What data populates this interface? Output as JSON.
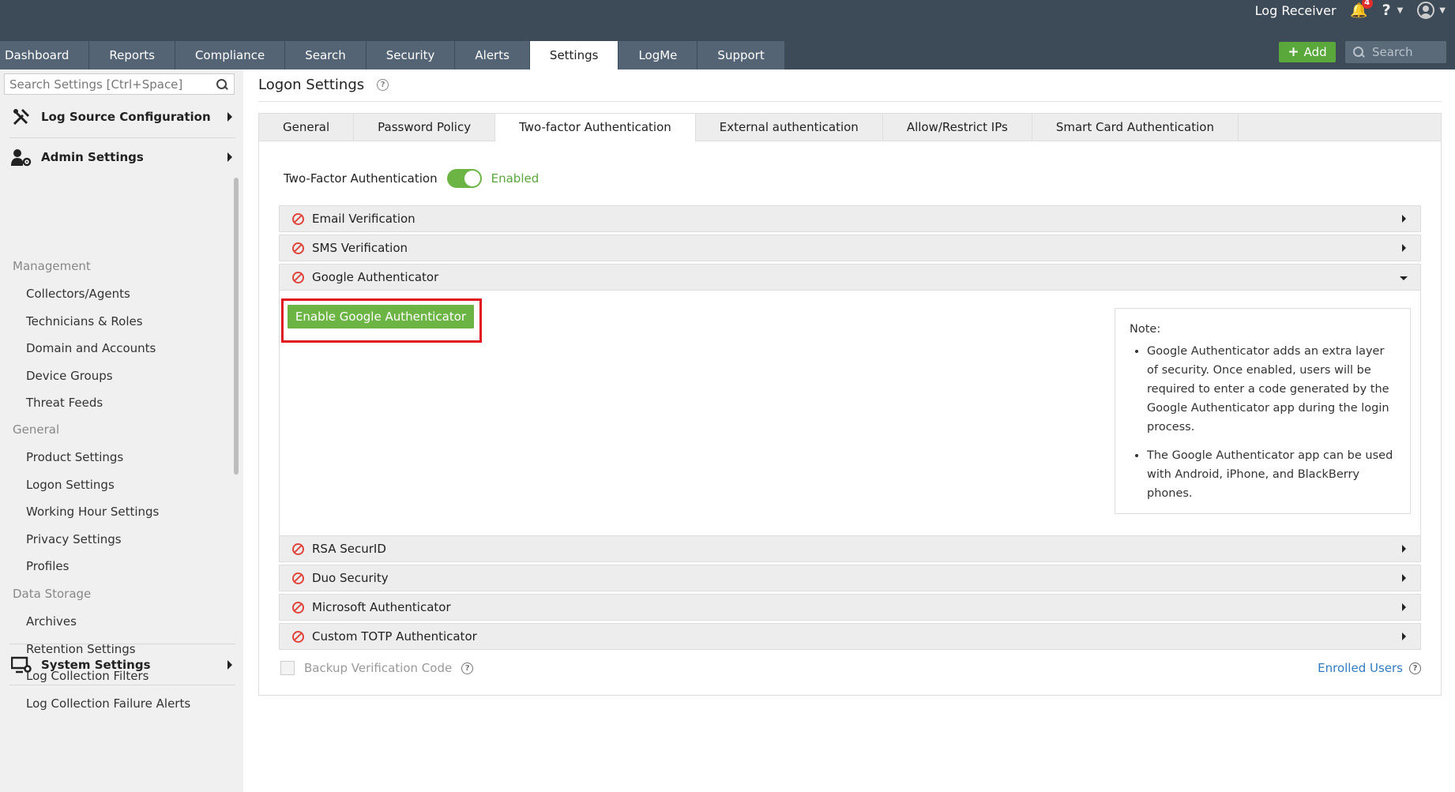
{
  "header": {
    "app_name": "Log Receiver",
    "notification_count": "4",
    "help_label": "?",
    "nav_tabs": [
      "Dashboard",
      "Reports",
      "Compliance",
      "Search",
      "Security",
      "Alerts",
      "Settings",
      "LogMe",
      "Support"
    ],
    "active_tab": "Settings",
    "add_label": "Add",
    "search_placeholder": "Search"
  },
  "sidebar": {
    "search_placeholder": "Search Settings [Ctrl+Space]",
    "log_source": "Log Source Configuration",
    "admin_settings": "Admin Settings",
    "groups": [
      {
        "title": "Management",
        "items": [
          "Collectors/Agents",
          "Technicians & Roles",
          "Domain and Accounts",
          "Device Groups",
          "Threat Feeds"
        ]
      },
      {
        "title": "General",
        "items": [
          "Product Settings",
          "Logon Settings",
          "Working Hour Settings",
          "Privacy Settings",
          "Profiles"
        ]
      },
      {
        "title": "Data Storage",
        "items": [
          "Archives",
          "Retention Settings",
          "Log Collection Filters",
          "Log Collection Failure Alerts"
        ]
      }
    ],
    "system_settings": "System Settings"
  },
  "main": {
    "title": "Logon Settings",
    "help": "?",
    "subtabs": [
      "General",
      "Password Policy",
      "Two-factor Authentication",
      "External authentication",
      "Allow/Restrict IPs",
      "Smart Card Authentication"
    ],
    "active_subtab": "Two-factor Authentication",
    "tfa_label": "Two-Factor Authentication",
    "tfa_state": "Enabled",
    "methods_top": [
      "Email Verification",
      "SMS Verification",
      "Google Authenticator"
    ],
    "methods_bottom": [
      "RSA SecurID",
      "Duo Security",
      "Microsoft Authenticator",
      "Custom TOTP Authenticator"
    ],
    "enable_button": "Enable Google Authenticator",
    "note": {
      "title": "Note:",
      "points": [
        "Google Authenticator adds an extra layer of security. Once enabled, users will be required to enter a code generated by the Google Authenticator app during the login process.",
        "The Google Authenticator app can be used with Android, iPhone, and BlackBerry phones."
      ]
    },
    "backup_label": "Backup Verification Code",
    "enrolled_label": "Enrolled Users"
  },
  "colors": {
    "header_bg": "#3d4a57",
    "tab_bg": "#546474",
    "accent_green": "#6cb545",
    "highlight_red": "#e0171f",
    "disabled_icon_red": "#e0443c",
    "link_blue": "#2f7bbf"
  }
}
